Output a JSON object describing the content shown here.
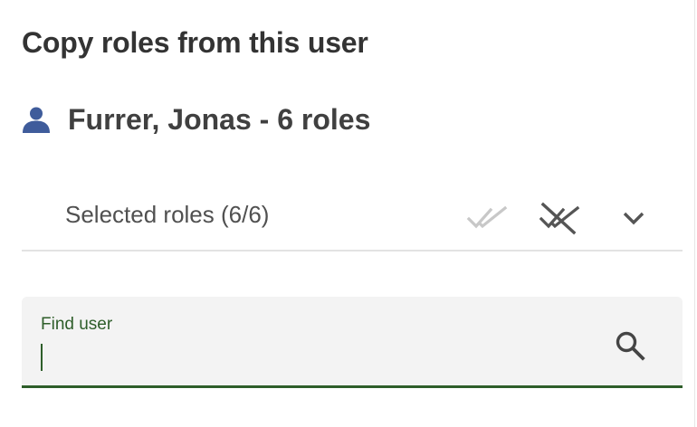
{
  "header": {
    "title": "Copy roles from this user"
  },
  "user": {
    "name_label": "Furrer, Jonas - 6 roles",
    "icon": "person-icon"
  },
  "selection": {
    "label": "Selected roles (6/6)",
    "actions": {
      "select_all_icon": "double-check-icon",
      "deselect_all_icon": "double-check-off-icon",
      "expand_icon": "chevron-down-icon"
    }
  },
  "find_user": {
    "label": "Find user",
    "value": "",
    "icon": "search-icon"
  },
  "colors": {
    "title_text": "#333333",
    "user_icon": "#3f5c9b",
    "accent_green": "#2e5e2a",
    "field_bg": "#f3f3f3",
    "divider": "#e3e3e3",
    "disabled_icon": "#c8c8c8",
    "active_icon": "#555555"
  }
}
